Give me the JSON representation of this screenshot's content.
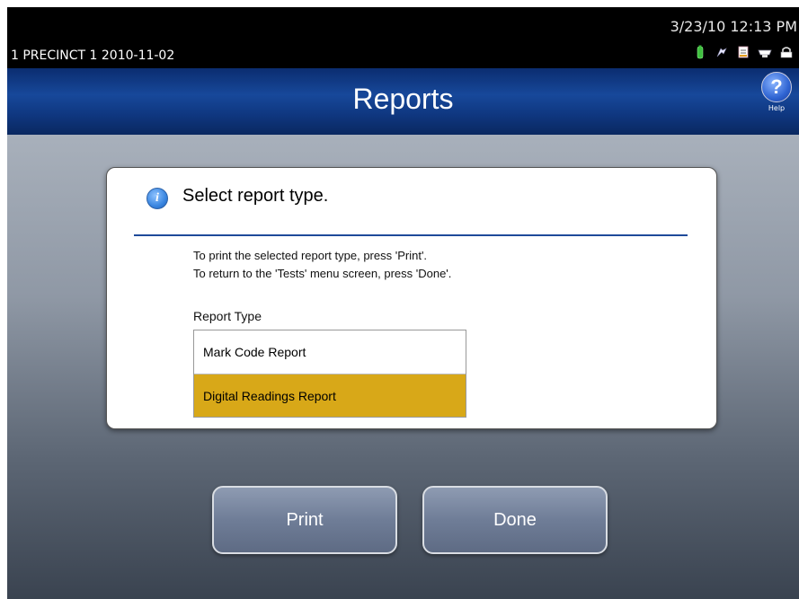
{
  "status": {
    "precinct_label": "1 PRECINCT 1   2010-11-02",
    "datetime": "3/23/10  12:13 PM",
    "icons": [
      "battery-icon",
      "power-plug-icon",
      "document-icon",
      "scanner-icon",
      "lock-icon"
    ]
  },
  "header": {
    "title": "Reports",
    "help_label": "Help",
    "help_glyph": "?"
  },
  "dialog": {
    "title": "Select report type.",
    "info_glyph": "i",
    "instruction_1": "To print the selected report type, press 'Print'.",
    "instruction_2": "To return to the 'Tests' menu screen, press 'Done'.",
    "report_type_label": "Report Type",
    "report_types": [
      {
        "label": "Mark Code Report",
        "selected": false
      },
      {
        "label": "Digital Readings Report",
        "selected": true
      }
    ]
  },
  "buttons": {
    "print_label": "Print",
    "done_label": "Done"
  },
  "colors": {
    "header_blue": "#17489a",
    "selected_highlight": "#d8a818",
    "divider_blue": "#1e4a9a"
  }
}
